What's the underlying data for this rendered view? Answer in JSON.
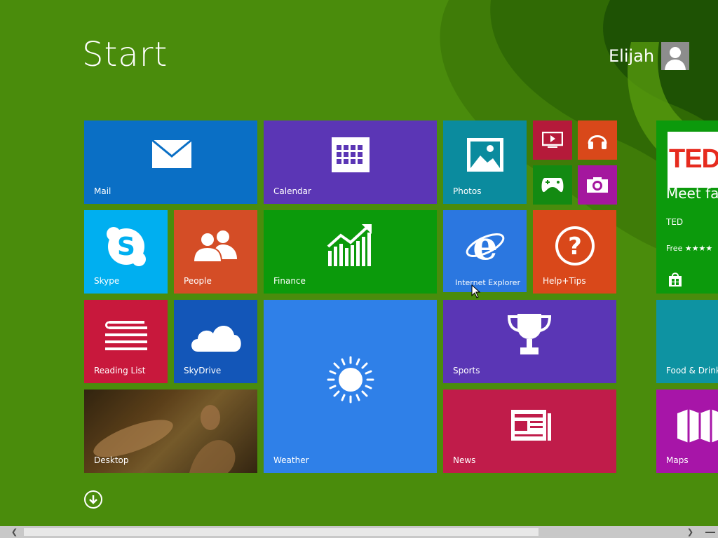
{
  "start": {
    "title": "Start"
  },
  "user": {
    "name": "Elijah"
  },
  "tiles": {
    "mail": {
      "label": "Mail"
    },
    "calendar": {
      "label": "Calendar"
    },
    "photos": {
      "label": "Photos"
    },
    "skype": {
      "label": "Skype"
    },
    "people": {
      "label": "People"
    },
    "finance": {
      "label": "Finance"
    },
    "internet_explorer": {
      "label": "Internet Explorer"
    },
    "help_tips": {
      "label": "Help+Tips"
    },
    "reading_list": {
      "label": "Reading List"
    },
    "skydrive": {
      "label": "SkyDrive"
    },
    "weather": {
      "label": "Weather"
    },
    "sports": {
      "label": "Sports"
    },
    "desktop": {
      "label": "Desktop"
    },
    "news": {
      "label": "News"
    },
    "ted": {
      "logo": "TED",
      "title": "Meet fas",
      "subtitle": "TED",
      "price": "Free ★★★★"
    },
    "food_drink": {
      "label": "Food & Drink"
    },
    "maps": {
      "label": "Maps"
    }
  },
  "colors": {
    "background": "#4a8c0c",
    "mail": "#0a6fc5",
    "calendar": "#5b36b5",
    "photos": "#0b8b9e",
    "video": "#b51a3a",
    "music": "#d9481a",
    "games": "#138a12",
    "camera": "#a4179e",
    "skype": "#00aff0",
    "people": "#d44d26",
    "finance": "#0b9a0b",
    "internet_explorer": "#2b77e0",
    "help_tips": "#d9481a",
    "reading_list": "#c8183c",
    "skydrive": "#1356b8",
    "weather": "#2f80e8",
    "sports": "#5a36b5",
    "news": "#c01c4a",
    "ted": "#0c9a0c",
    "food_drink": "#0e93a2",
    "maps": "#a715a8"
  },
  "icons": [
    "envelope-icon",
    "calendar-icon",
    "photos-icon",
    "video-icon",
    "headphones-icon",
    "gamepad-icon",
    "camera-icon",
    "skype-icon",
    "people-icon",
    "finance-chart-icon",
    "internet-explorer-icon",
    "help-icon",
    "reading-list-icon",
    "cloud-icon",
    "sun-icon",
    "trophy-icon",
    "news-icon",
    "store-icon",
    "map-icon",
    "down-arrow-icon",
    "user-icon"
  ]
}
